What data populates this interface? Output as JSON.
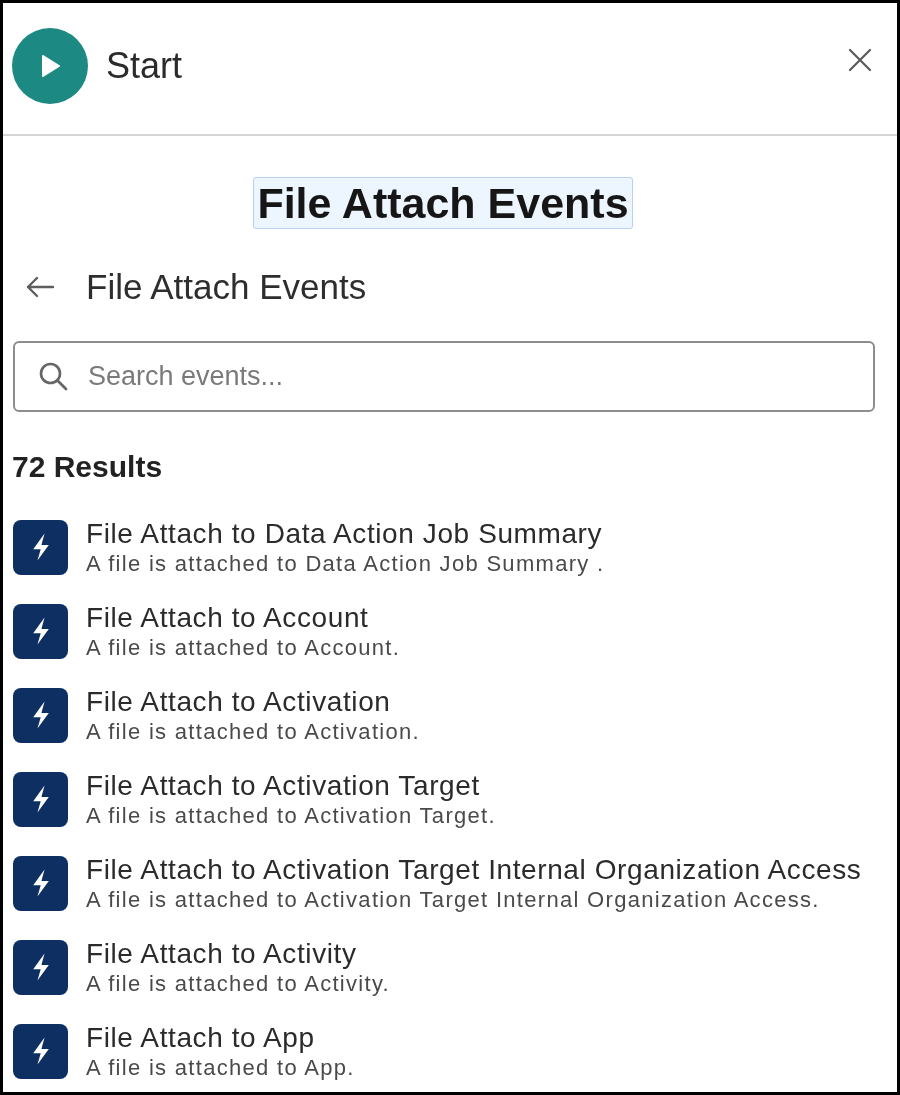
{
  "header": {
    "title": "Start"
  },
  "page_title": {
    "text": "File Attach Events",
    "highlighted": true
  },
  "breadcrumb": {
    "label": "File Attach Events"
  },
  "search": {
    "placeholder": "Search events..."
  },
  "results_count": "72 Results",
  "events": [
    {
      "title": "File Attach to Data Action Job Summary",
      "description": "A file is attached to Data Action Job Summary ."
    },
    {
      "title": "File Attach to Account",
      "description": "A file is attached to Account."
    },
    {
      "title": "File Attach to Activation",
      "description": "A file is attached to Activation."
    },
    {
      "title": "File Attach to Activation Target",
      "description": "A file is attached to Activation Target."
    },
    {
      "title": "File Attach to Activation Target Internal Organization Access",
      "description": "A file is attached to Activation Target Internal Organization Access."
    },
    {
      "title": "File Attach to Activity",
      "description": "A file is attached to Activity."
    },
    {
      "title": "File Attach to App",
      "description": "A file is attached to App."
    }
  ]
}
